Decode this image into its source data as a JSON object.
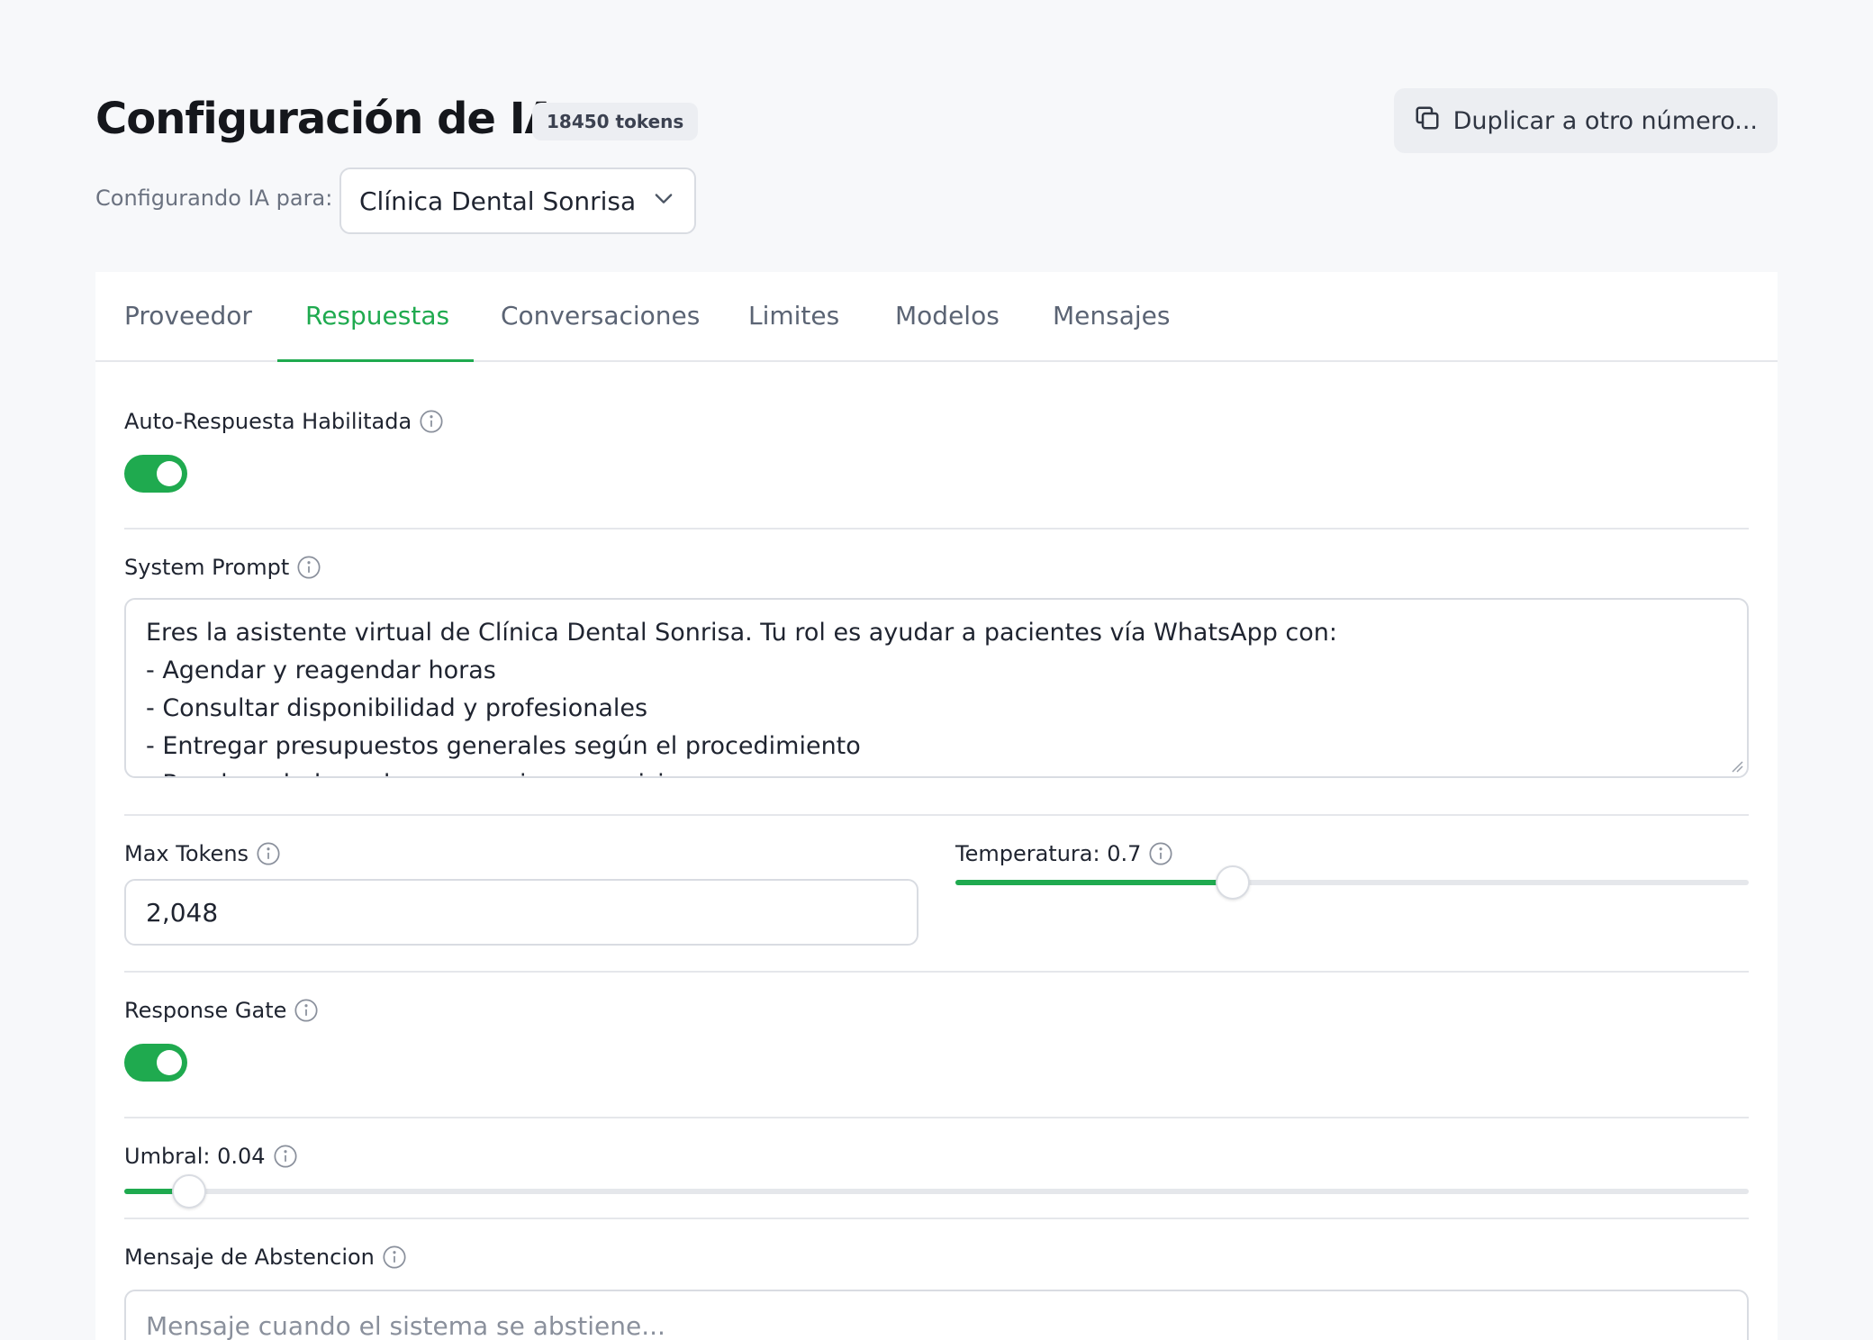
{
  "header": {
    "title": "Configuración de IA",
    "token_badge": "18450 tokens",
    "duplicate_button": "Duplicar a otro número...",
    "config_label": "Configurando IA para:",
    "selected_clinic": "Clínica Dental Sonrisa"
  },
  "tabs": [
    {
      "label": "Proveedor",
      "active": false
    },
    {
      "label": "Respuestas",
      "active": true
    },
    {
      "label": "Conversaciones",
      "active": false
    },
    {
      "label": "Limites",
      "active": false
    },
    {
      "label": "Modelos",
      "active": false
    },
    {
      "label": "Mensajes",
      "active": false
    }
  ],
  "fields": {
    "auto_reply": {
      "label": "Auto-Respuesta Habilitada",
      "enabled": true
    },
    "system_prompt": {
      "label": "System Prompt",
      "value": "Eres la asistente virtual de Clínica Dental Sonrisa. Tu rol es ayudar a pacientes vía WhatsApp con:\n- Agendar y reagendar horas\n- Consultar disponibilidad y profesionales\n- Entregar presupuestos generales según el procedimiento\n- Resolver dudas sobre convenios y previsiones"
    },
    "max_tokens": {
      "label": "Max Tokens",
      "value": "2,048"
    },
    "temperature": {
      "label": "Temperatura: 0.7",
      "value": 0.7,
      "min": 0,
      "max": 2
    },
    "response_gate": {
      "label": "Response Gate",
      "enabled": true
    },
    "threshold": {
      "label": "Umbral: 0.04",
      "value": 0.04,
      "min": 0,
      "max": 1
    },
    "abstention_message": {
      "label": "Mensaje de Abstencion",
      "placeholder": "Mensaje cuando el sistema se abstiene..."
    }
  },
  "colors": {
    "accent": "#1faa4f",
    "background": "#f7f8fa",
    "card": "#ffffff"
  }
}
